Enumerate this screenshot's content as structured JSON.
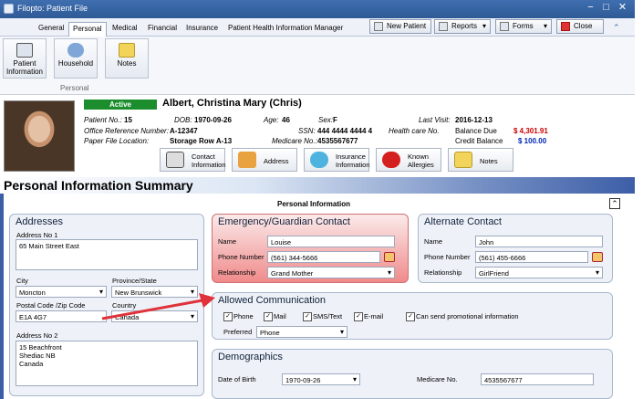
{
  "window": {
    "title": "Filopto: Patient File",
    "min": "−",
    "max": "□",
    "close": "✕"
  },
  "tabs": [
    "General",
    "Personal",
    "Medical",
    "Financial",
    "Insurance",
    "Patient Health Information Manager"
  ],
  "toolbar": {
    "new_patient": "New Patient",
    "reports": "Reports",
    "forms": "Forms",
    "close": "Close"
  },
  "ribbon": {
    "buttons": [
      "Patient Information",
      "Household",
      "Notes"
    ],
    "group": "Personal"
  },
  "patient": {
    "status": "Active",
    "name": "Albert, Christina Mary (Chris)",
    "patient_no_label": "Patient No.:",
    "patient_no": "15",
    "dob_label": "DOB:",
    "dob": "1970-09-26",
    "age_label": "Age:",
    "age": "46",
    "sex_label": "Sex:",
    "sex": "F",
    "last_visit_label": "Last Visit:",
    "last_visit": "2016-12-13",
    "office_ref_label": "Office Reference Number:",
    "office_ref": "A-12347",
    "ssn_label": "SSN:",
    "ssn": "444 4444 4444 4",
    "hcn_label": "Health care No.",
    "balance_due_label": "Balance Due",
    "balance_due": "$ 4,301.91",
    "paper_label": "Paper File Location:",
    "paper": "Storage Row A-13",
    "medicare_label": "Medicare No.:",
    "medicare": "4535567677",
    "credit_label": "Credit Balance",
    "credit": "$ 100.00"
  },
  "patient_buttons": [
    "Contact Information",
    "Address",
    "Insurance Information",
    "Known Allergies",
    "Notes"
  ],
  "summary": {
    "title": "Personal Information Summary",
    "subtitle": "Personal Information",
    "collapse": "⌃"
  },
  "addresses": {
    "title": "Addresses",
    "addr1_label": "Address No 1",
    "addr1": "65 Main Street East",
    "city_label": "City",
    "city": "Moncton",
    "province_label": "Province/State",
    "province": "New Brunswick",
    "postal_label": "Postal Code /Zip Code",
    "postal": "E1A 4G7",
    "country_label": "Country",
    "country": "Canada",
    "addr2_label": "Address No 2",
    "addr2_line1": "15 Beachfront",
    "addr2_line2": "Shediac NB",
    "addr2_line3": "Canada"
  },
  "emergency": {
    "title": "Emergency/Guardian Contact",
    "name_label": "Name",
    "name": "Louise",
    "phone_label": "Phone Number",
    "phone": "(561) 344-5666",
    "rel_label": "Relationship",
    "rel": "Grand Mother"
  },
  "alternate": {
    "title": "Alternate Contact",
    "name_label": "Name",
    "name": "John",
    "phone_label": "Phone Number",
    "phone": "(561) 455-6666",
    "rel_label": "Relationship",
    "rel": "GirlFriend"
  },
  "communication": {
    "title": "Allowed Communication",
    "options": [
      "Phone",
      "Mail",
      "SMS/Text",
      "E-mail",
      "Can send promotional information"
    ],
    "pref_label": "Preferred",
    "pref": "Phone"
  },
  "demographics": {
    "title": "Demographics",
    "dob_label": "Date of Birth",
    "dob": "1970-09-26",
    "medicare_label": "Medicare  No.",
    "medicare": "4535567677"
  },
  "colors": {
    "active": "#1b8d2c",
    "balance_due": "#cc0000",
    "credit": "#0026b4",
    "arrow": "#e0323a"
  }
}
